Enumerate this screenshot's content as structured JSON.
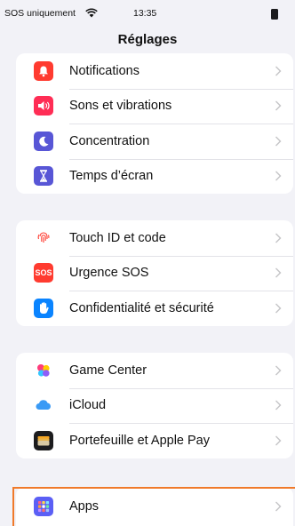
{
  "status_bar": {
    "carrier": "SOS uniquement",
    "time": "13:35"
  },
  "header": {
    "title": "Réglages"
  },
  "groups": [
    {
      "items": [
        {
          "label": "Notifications"
        },
        {
          "label": "Sons et vibrations"
        },
        {
          "label": "Concentration"
        },
        {
          "label": "Temps d’écran"
        }
      ]
    },
    {
      "items": [
        {
          "label": "Touch ID et code"
        },
        {
          "label": "Urgence SOS",
          "icon_text": "SOS"
        },
        {
          "label": "Confidentialité et sécurité"
        }
      ]
    },
    {
      "items": [
        {
          "label": "Game Center"
        },
        {
          "label": "iCloud"
        },
        {
          "label": "Portefeuille et Apple Pay"
        }
      ]
    },
    {
      "items": [
        {
          "label": "Apps"
        }
      ]
    }
  ],
  "colors": {
    "background": "#f2f2f7",
    "highlight": "#f07a2a",
    "notifications": "#ff3b30",
    "sounds": "#ff2d55",
    "focus": "#5856d6",
    "screen_time": "#5856d6",
    "sos": "#ff3b30",
    "privacy": "#0a84ff",
    "icloud": "#3a9af5"
  }
}
